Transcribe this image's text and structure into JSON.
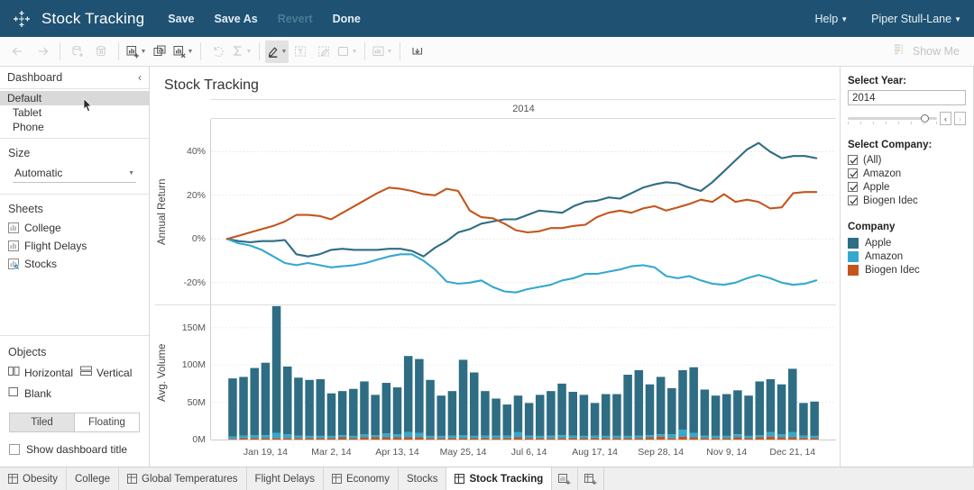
{
  "topbar": {
    "logo_icon": "tableau-logo-icon",
    "title": "Stock Tracking",
    "menu": [
      {
        "label": "Save",
        "disabled": false
      },
      {
        "label": "Save As",
        "disabled": false
      },
      {
        "label": "Revert",
        "disabled": true
      },
      {
        "label": "Done",
        "disabled": false
      }
    ],
    "help_label": "Help",
    "user_label": "Piper Stull-Lane",
    "caret": "▼"
  },
  "toolbar": {
    "back_icon": "back-arrow-icon",
    "forward_icon": "forward-arrow-icon",
    "new_data_source_icon": "new-data-source-icon",
    "pause_data_icon": "pause-data-updates-icon",
    "new_worksheet_icon": "new-worksheet-icon",
    "duplicate_sheet_icon": "duplicate-sheet-icon",
    "clear_sheet_icon": "clear-sheet-icon",
    "swap_icon": "swap-rows-columns-icon",
    "totals_icon": "totals-icon",
    "highlighter_icon": "highlighter-icon",
    "text_icon": "text-icon",
    "edit_icon": "edit-icon",
    "container_icon": "container-icon",
    "fit_icon": "fit-icon",
    "download_icon": "download-icon",
    "show_me_label": "Show Me",
    "show_me_icon": "show-me-icon"
  },
  "left_panel": {
    "header": "Dashboard",
    "collapse_icon": "chevron-left-icon",
    "devices": [
      {
        "label": "Default",
        "selected": true
      },
      {
        "label": "Tablet",
        "selected": false
      },
      {
        "label": "Phone",
        "selected": false
      }
    ],
    "size_label": "Size",
    "size_value": "Automatic",
    "sheets_label": "Sheets",
    "sheets": [
      {
        "label": "College",
        "icon": "worksheet-icon"
      },
      {
        "label": "Flight Delays",
        "icon": "worksheet-icon"
      },
      {
        "label": "Stocks",
        "icon": "worksheet-active-icon"
      }
    ],
    "objects_label": "Objects",
    "objects": [
      {
        "label": "Horizontal",
        "icon": "horizontal-container-icon"
      },
      {
        "label": "Vertical",
        "icon": "vertical-container-icon"
      },
      {
        "label": "Blank",
        "icon": "blank-object-icon"
      }
    ],
    "layout_tiled": "Tiled",
    "layout_floating": "Floating",
    "layout_selected": "Tiled",
    "show_title_label": "Show dashboard title",
    "show_title_checked": false
  },
  "dashboard": {
    "title": "Stock Tracking"
  },
  "right_panel": {
    "year_filter_title": "Select Year:",
    "year_value": "2014",
    "prev_icon": "chevron-left-icon",
    "next_icon": "chevron-right-icon",
    "company_filter_title": "Select Company:",
    "company_filters": [
      {
        "label": "(All)",
        "checked": true
      },
      {
        "label": "Amazon",
        "checked": true
      },
      {
        "label": "Apple",
        "checked": true
      },
      {
        "label": "Biogen Idec",
        "checked": true
      }
    ],
    "legend_title": "Company",
    "legend": [
      {
        "label": "Apple",
        "color": "#2e6d83"
      },
      {
        "label": "Amazon",
        "color": "#34a8cf"
      },
      {
        "label": "Biogen Idec",
        "color": "#c4551c"
      }
    ]
  },
  "tabs": {
    "items": [
      {
        "label": "Obesity",
        "icon": "dashboard-icon",
        "active": false
      },
      {
        "label": "College",
        "icon": "none",
        "active": false
      },
      {
        "label": "Global Temperatures",
        "icon": "dashboard-icon",
        "active": false
      },
      {
        "label": "Flight Delays",
        "icon": "none",
        "active": false
      },
      {
        "label": "Economy",
        "icon": "dashboard-icon",
        "active": false
      },
      {
        "label": "Stocks",
        "icon": "none",
        "active": false
      },
      {
        "label": "Stock Tracking",
        "icon": "dashboard-icon",
        "active": true
      }
    ],
    "new_sheet_icon": "new-worksheet-icon",
    "new_dashboard_icon": "new-dashboard-icon"
  },
  "chart_data": [
    {
      "type": "line",
      "title": "",
      "column_header": "2014",
      "xlabel": "",
      "ylabel": "Annual Return",
      "ylim": [
        -30,
        55
      ],
      "yticks": [
        40,
        20,
        0,
        -20
      ],
      "ytick_labels": [
        "40%",
        "20%",
        "0%",
        "-20%"
      ],
      "grid": true,
      "legend_position": "right",
      "x_count": 52,
      "series": [
        {
          "name": "Apple",
          "color": "#2e6d83",
          "values": [
            0,
            -1,
            -1.5,
            -1,
            -1,
            -0.5,
            -7,
            -8,
            -7,
            -5,
            -4.5,
            -5,
            -5,
            -5,
            -4.5,
            -4.5,
            -5.5,
            -8,
            -4,
            -1,
            3,
            4.5,
            7,
            8,
            9,
            9,
            11,
            13,
            12.5,
            12,
            15,
            17,
            17.5,
            19,
            18.5,
            21,
            23.5,
            25,
            26,
            25.5,
            23.5,
            22,
            26,
            31,
            36,
            41,
            44,
            40,
            37,
            38,
            38,
            37
          ]
        },
        {
          "name": "Amazon",
          "color": "#34a8cf",
          "values": [
            0,
            -2,
            -3,
            -5,
            -8,
            -11,
            -12,
            -11,
            -12,
            -13,
            -12.5,
            -12,
            -11,
            -9.5,
            -8,
            -7,
            -7,
            -10,
            -14,
            -19.5,
            -20.5,
            -20,
            -19,
            -22,
            -24,
            -24.5,
            -23,
            -22,
            -21,
            -19,
            -18,
            -16,
            -16,
            -15,
            -14,
            -12.5,
            -12,
            -13,
            -17,
            -18,
            -17,
            -19,
            -20.5,
            -21,
            -20,
            -18,
            -16.5,
            -18,
            -20,
            -21,
            -20.5,
            -19
          ]
        },
        {
          "name": "Biogen Idec",
          "color": "#c4551c",
          "values": [
            0,
            1.5,
            3,
            4.5,
            6,
            8,
            11,
            11,
            10.5,
            9,
            12,
            15,
            18,
            21,
            23.5,
            23,
            22,
            20.5,
            20,
            23,
            22,
            13,
            10,
            9.5,
            7,
            4,
            3,
            3.5,
            5,
            5,
            6,
            6.5,
            10,
            12,
            13,
            12,
            14,
            15,
            13,
            14.5,
            16,
            18,
            17,
            20.5,
            17,
            18,
            17,
            14,
            14.5,
            21,
            21.5,
            21.5
          ]
        }
      ]
    },
    {
      "type": "bar",
      "stacked": true,
      "title": "",
      "xlabel": "",
      "ylabel": "Avg. Volume",
      "ylim": [
        0,
        180
      ],
      "yticks": [
        150,
        100,
        50,
        0
      ],
      "ytick_labels": [
        "150M",
        "100M",
        "50M",
        "0M"
      ],
      "xticks": [
        "Jan 19, 14",
        "Mar 2, 14",
        "Apr 13, 14",
        "May 25, 14",
        "Jul 6, 14",
        "Aug 17, 14",
        "Sep 28, 14",
        "Nov 9, 14",
        "Dec 21, 14"
      ],
      "grid": true,
      "series": [
        {
          "name": "Apple",
          "color": "#2e6d83",
          "values": [
            78,
            79,
            90,
            97,
            170,
            91,
            78,
            75,
            76,
            57,
            59,
            63,
            71,
            54,
            68,
            63,
            102,
            99,
            75,
            54,
            60,
            101,
            85,
            60,
            50,
            42,
            49,
            44,
            55,
            60,
            69,
            59,
            55,
            44,
            56,
            56,
            82,
            88,
            68,
            77,
            62,
            80,
            88,
            62,
            54,
            56,
            59,
            54,
            72,
            71,
            67,
            85,
            44,
            46
          ]
        },
        {
          "name": "Amazon",
          "color": "#34a8cf",
          "values": [
            3,
            3,
            4,
            4,
            7,
            5,
            3,
            3,
            3,
            3,
            3,
            3,
            4,
            3,
            5,
            4,
            7,
            6,
            3,
            3,
            3,
            4,
            3,
            3,
            3,
            3,
            7,
            3,
            3,
            3,
            4,
            3,
            3,
            3,
            3,
            3,
            3,
            3,
            3,
            3,
            5,
            9,
            6,
            3,
            3,
            3,
            4,
            3,
            3,
            6,
            4,
            7,
            3,
            3
          ]
        },
        {
          "name": "Biogen Idec",
          "color": "#c4551c",
          "values": [
            1,
            2,
            2,
            2,
            2,
            2,
            2,
            2,
            2,
            2,
            3,
            2,
            3,
            3,
            3,
            3,
            3,
            3,
            2,
            2,
            2,
            2,
            2,
            2,
            2,
            2,
            3,
            2,
            2,
            2,
            2,
            2,
            2,
            2,
            2,
            2,
            2,
            2,
            3,
            4,
            2,
            4,
            3,
            2,
            2,
            2,
            3,
            2,
            3,
            4,
            3,
            3,
            2,
            2
          ]
        }
      ]
    }
  ]
}
